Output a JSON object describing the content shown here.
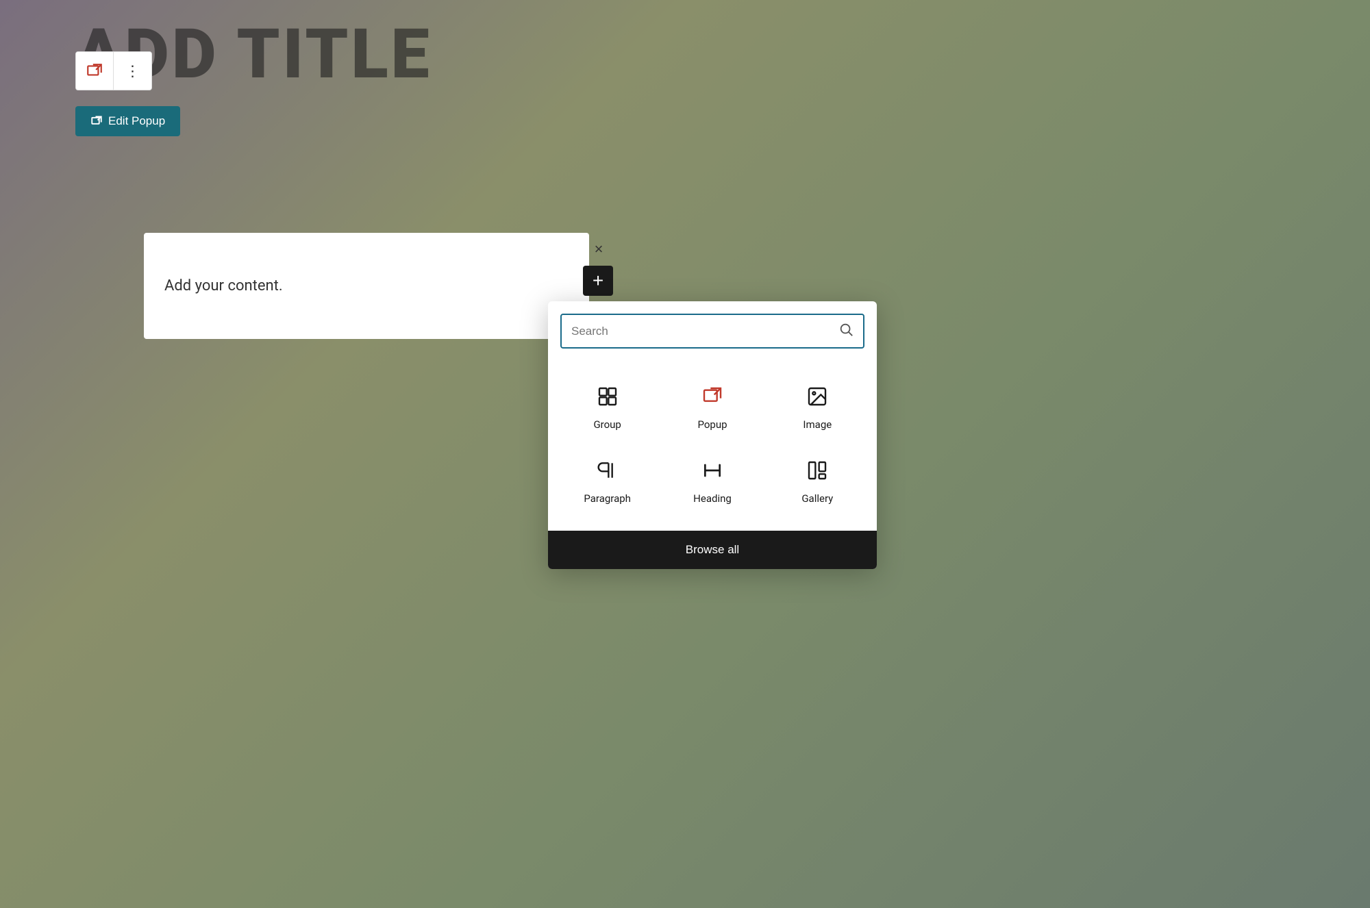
{
  "page": {
    "title": "ADD TITLE",
    "background": "gradient-muted-olive"
  },
  "toolbar": {
    "popup_icon_label": "popup-icon",
    "menu_icon_label": "⋮"
  },
  "edit_popup_button": {
    "label": "Edit Popup",
    "icon": "external-link"
  },
  "content_block": {
    "placeholder": "Add your content."
  },
  "close_button": {
    "label": "×"
  },
  "add_button": {
    "label": "+"
  },
  "inserter": {
    "search": {
      "placeholder": "Search"
    },
    "blocks": [
      {
        "id": "group",
        "label": "Group",
        "icon": "group"
      },
      {
        "id": "popup",
        "label": "Popup",
        "icon": "popup"
      },
      {
        "id": "image",
        "label": "Image",
        "icon": "image"
      },
      {
        "id": "paragraph",
        "label": "Paragraph",
        "icon": "paragraph"
      },
      {
        "id": "heading",
        "label": "Heading",
        "icon": "heading"
      },
      {
        "id": "gallery",
        "label": "Gallery",
        "icon": "gallery"
      }
    ],
    "browse_all_label": "Browse all"
  }
}
